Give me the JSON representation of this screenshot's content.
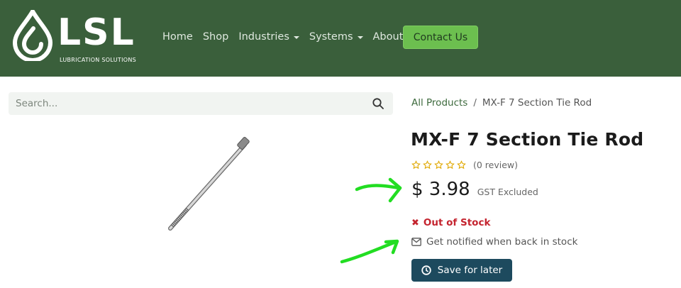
{
  "header": {
    "logo_text": "LSL",
    "logo_subtext": "LUBRICATION SOLUTIONS",
    "nav": [
      {
        "label": "Home"
      },
      {
        "label": "Shop"
      },
      {
        "label": "Industries"
      },
      {
        "label": "Systems"
      },
      {
        "label": "About"
      }
    ],
    "contact_label": "Contact Us",
    "background_color": "#3a5f3b",
    "contact_color": "#6cbf4f"
  },
  "search": {
    "placeholder": "Search..."
  },
  "breadcrumb": {
    "parent": "All Products",
    "separator": "/",
    "current": "MX-F 7 Section Tie Rod"
  },
  "product": {
    "title": "MX-F 7 Section Tie Rod",
    "rating_stars": 0,
    "review_count": "(0 review)",
    "price": "$ 3.98",
    "price_note": "GST Excluded",
    "stock_status": "Out of Stock",
    "notify_label": "Get notified when back in stock",
    "save_label": "Save for later"
  },
  "colors": {
    "stock_out": "#c4242f",
    "save_button": "#1d4a5e",
    "annotation_arrow": "#22dd22",
    "star_outline": "#e0a800"
  }
}
